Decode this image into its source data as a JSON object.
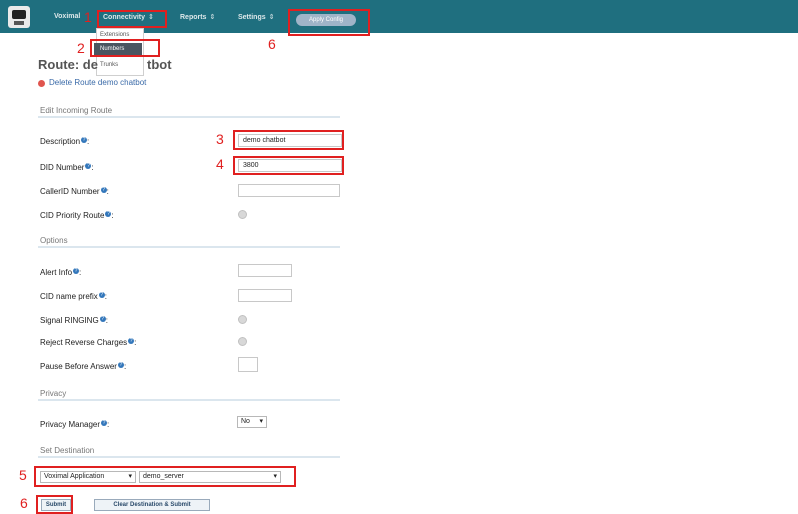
{
  "nav": {
    "items": [
      {
        "label": "Voximal",
        "caret": ""
      },
      {
        "label": "Connectivity",
        "caret": "⇕"
      },
      {
        "label": "Reports",
        "caret": "⇕"
      },
      {
        "label": "Settings",
        "caret": "⇕"
      }
    ],
    "apply_label": "Apply Config"
  },
  "dropdown": {
    "items": [
      "Extensions",
      "Numbers",
      "Trunks"
    ],
    "selected": "Numbers"
  },
  "page": {
    "title_left": "Route: de",
    "title_right": "tbot",
    "delete_label": "Delete Route demo chatbot"
  },
  "sections": {
    "edit": "Edit Incoming Route",
    "options": "Options",
    "privacy": "Privacy",
    "destination": "Set Destination"
  },
  "fields": {
    "description": {
      "label": "Description",
      "value": "demo chatbot"
    },
    "did": {
      "label": "DID Number",
      "value": "3800"
    },
    "callerid": {
      "label": "CallerID Number",
      "value": ""
    },
    "cid_priority": {
      "label": "CID Priority Route"
    },
    "alert_info": {
      "label": "Alert Info",
      "value": ""
    },
    "cid_prefix": {
      "label": "CID name prefix",
      "value": ""
    },
    "signal_ringing": {
      "label": "Signal RINGING"
    },
    "reject_reverse": {
      "label": "Reject Reverse Charges"
    },
    "pause_answer": {
      "label": "Pause Before Answer",
      "value": ""
    },
    "privacy_manager": {
      "label": "Privacy Manager",
      "value": "No"
    }
  },
  "destination": {
    "type": "Voximal Application",
    "target": "demo_server"
  },
  "buttons": {
    "submit": "Submit",
    "clear_submit": "Clear Destination & Submit"
  },
  "annotations": [
    "1",
    "2",
    "3",
    "4",
    "5",
    "6",
    "6"
  ],
  "help_glyph": "?",
  "colors": {
    "topbar": "#1f6f7f",
    "callout": "#e02020",
    "link": "#3a6aa8"
  }
}
